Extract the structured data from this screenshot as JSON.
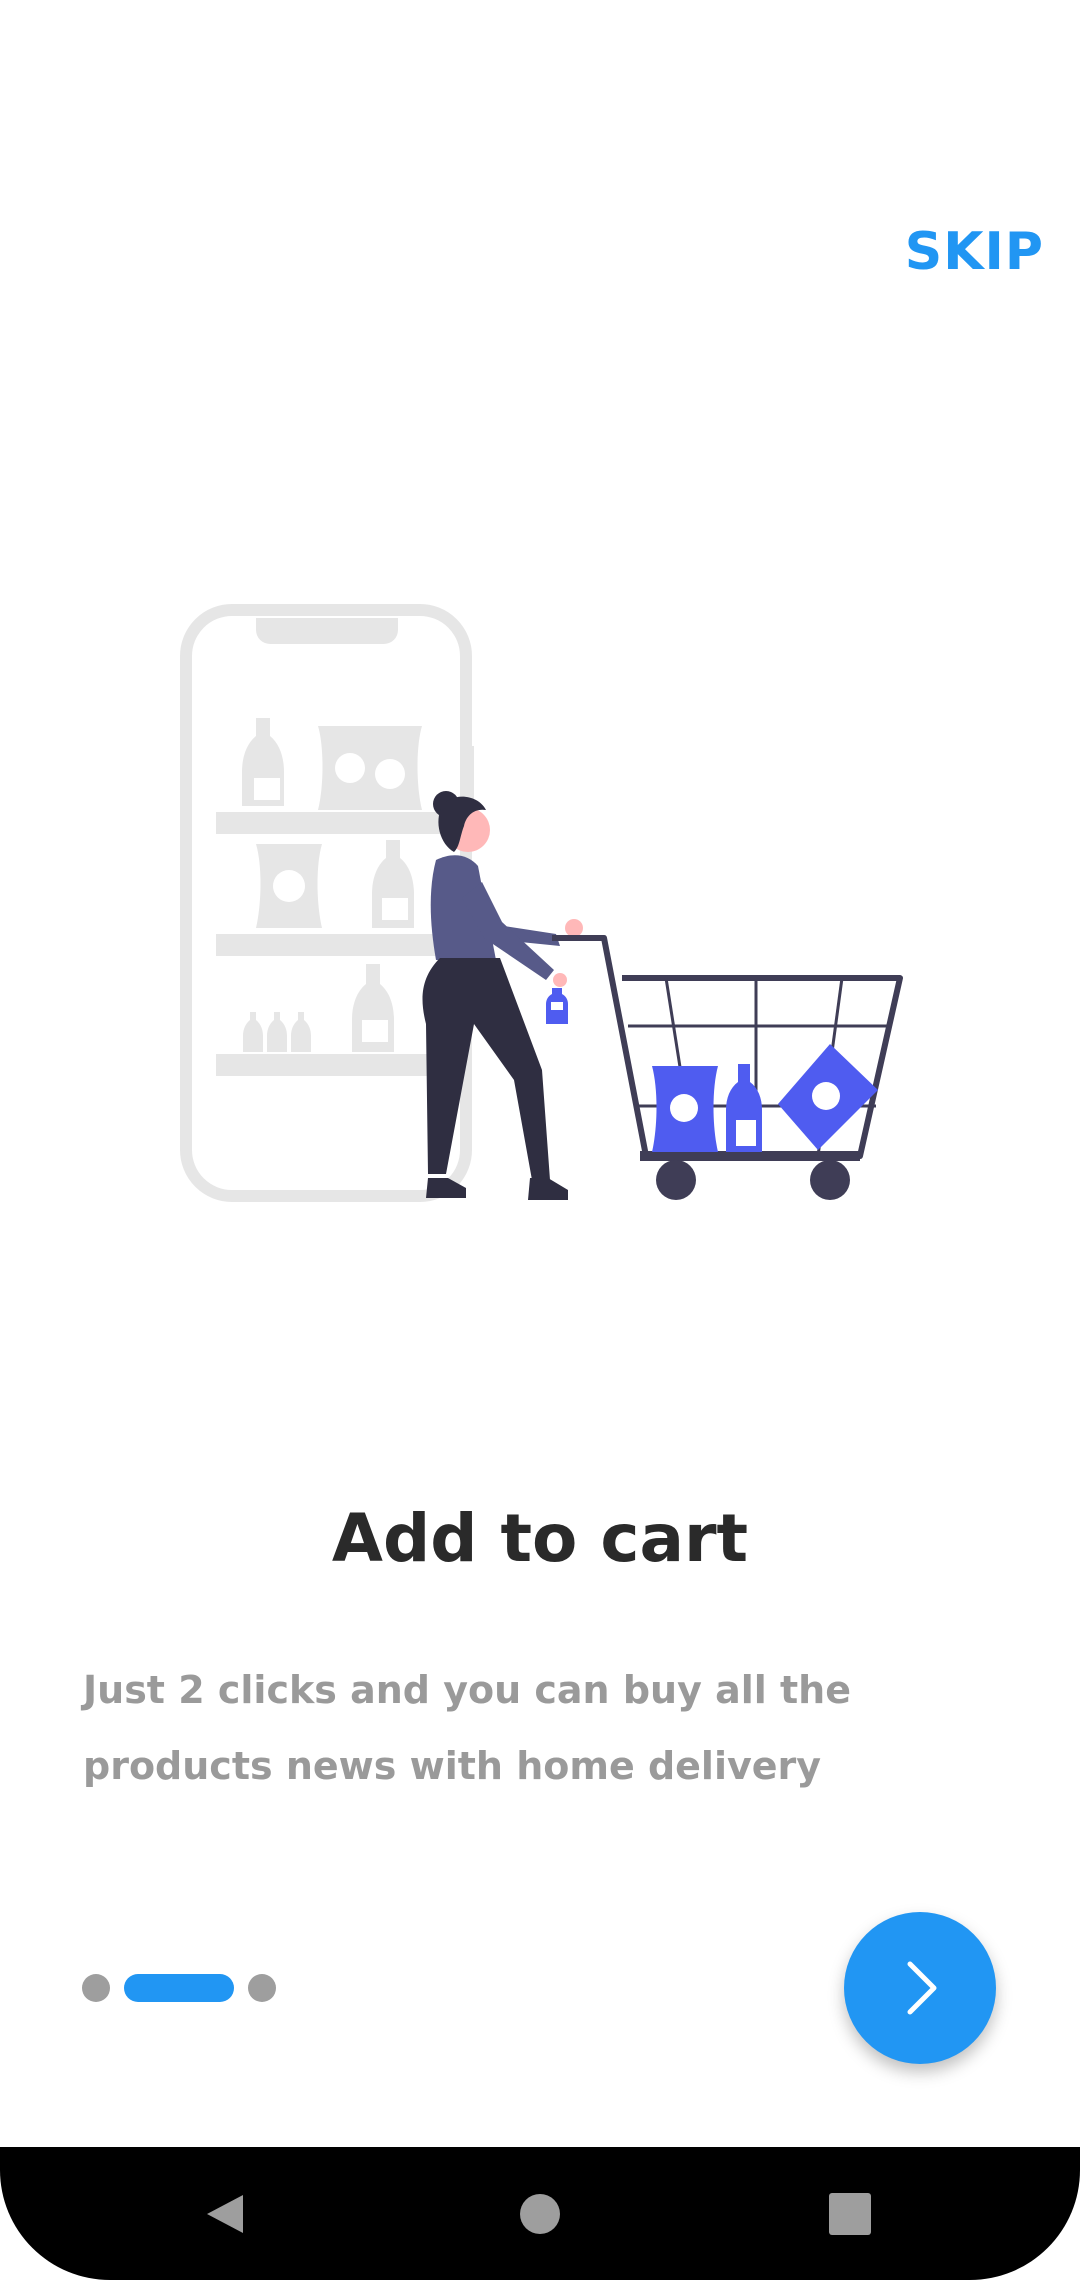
{
  "header": {
    "skip_label": "SKIP"
  },
  "onboarding": {
    "illustration": "woman-with-shopping-cart-illustration",
    "title": "Add to cart",
    "description": "Just 2 clicks and you can buy all the products news with home delivery",
    "pager": {
      "total_pages": 3,
      "current_page": 2
    },
    "next_icon": "chevron-right-icon"
  },
  "system_nav": {
    "back_icon": "back-triangle-icon",
    "home_icon": "home-circle-icon",
    "recents_icon": "recents-square-icon"
  },
  "colors": {
    "accent": "#2196F3",
    "title": "#2a2a2a",
    "description": "#9a9a9a",
    "inactive_dot": "#9e9e9e",
    "illustration_primary": "#4f5cf0",
    "illustration_dark": "#3f3d56",
    "illustration_light": "#e6e6e6"
  }
}
